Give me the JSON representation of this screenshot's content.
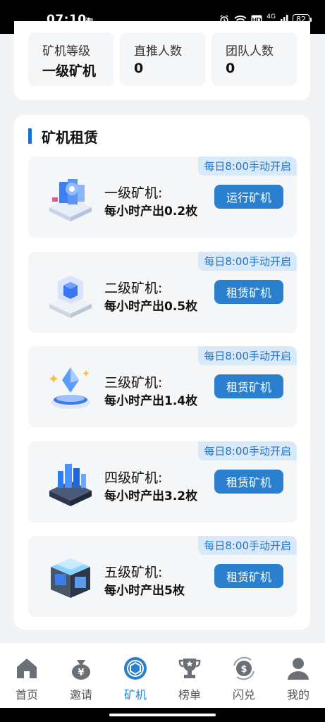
{
  "status_bar": {
    "time": "07:10",
    "app_glyph": "淘",
    "battery": "82",
    "network": "4G"
  },
  "stats": [
    {
      "label": "矿机等级",
      "value": "一级矿机"
    },
    {
      "label": "直推人数",
      "value": "0"
    },
    {
      "label": "团队人数",
      "value": "0"
    }
  ],
  "rental": {
    "title": "矿机租赁",
    "machines": [
      {
        "badge": "每日8:00手动开启",
        "name": "一级矿机:",
        "rate": "每小时产出0.2枚",
        "button": "运行矿机",
        "icon": "server-stack-icon"
      },
      {
        "badge": "每日8:00手动开启",
        "name": "二级矿机:",
        "rate": "每小时产出0.5枚",
        "button": "租赁矿机",
        "icon": "glass-cube-icon"
      },
      {
        "badge": "每日8:00手动开启",
        "name": "三级矿机:",
        "rate": "每小时产出1.4枚",
        "button": "租赁矿机",
        "icon": "crystal-icon"
      },
      {
        "badge": "每日8:00手动开启",
        "name": "四级矿机:",
        "rate": "每小时产出3.2枚",
        "button": "租赁矿机",
        "icon": "city-block-icon"
      },
      {
        "badge": "每日8:00手动开启",
        "name": "五级矿机:",
        "rate": "每小时产出5枚",
        "button": "租赁矿机",
        "icon": "data-center-icon"
      }
    ]
  },
  "nav": [
    {
      "label": "首页",
      "icon": "home-icon",
      "active": false
    },
    {
      "label": "邀请",
      "icon": "money-bag-icon",
      "active": false
    },
    {
      "label": "矿机",
      "icon": "miner-icon",
      "active": true
    },
    {
      "label": "榜单",
      "icon": "trophy-icon",
      "active": false
    },
    {
      "label": "闪兑",
      "icon": "exchange-icon",
      "active": false
    },
    {
      "label": "我的",
      "icon": "user-icon",
      "active": false
    }
  ],
  "colors": {
    "accent": "#2a80cf",
    "badge_bg": "#d9e9f7",
    "badge_text": "#1f74c9",
    "section_bar": "#1f6fd1"
  }
}
